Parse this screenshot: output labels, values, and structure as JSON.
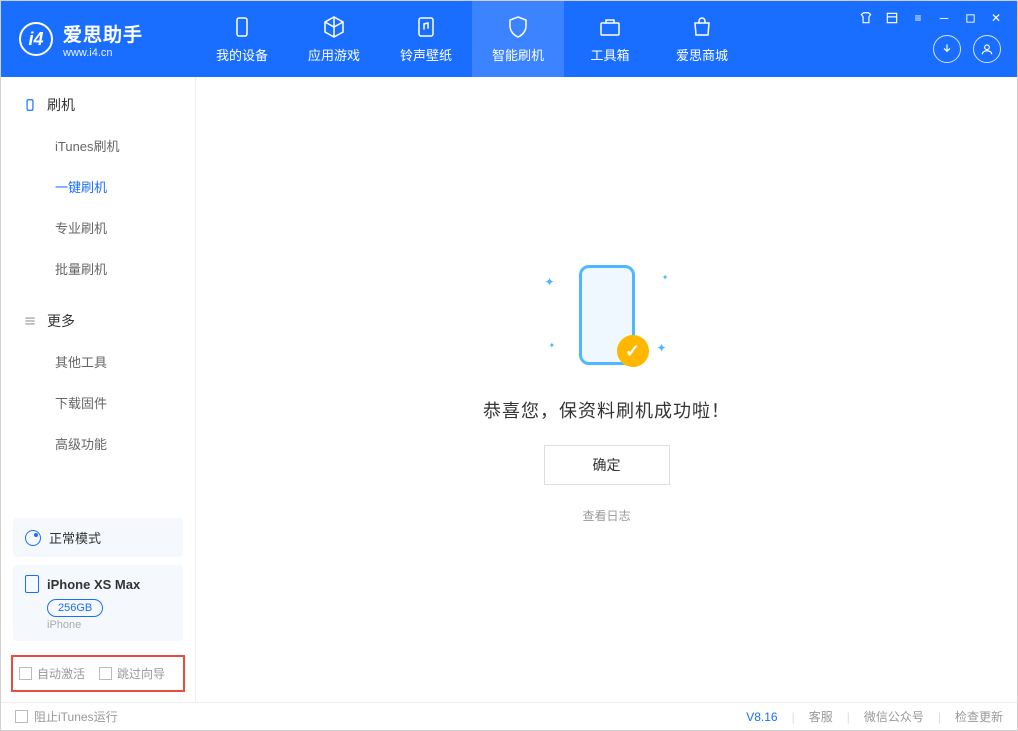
{
  "app": {
    "title": "爱思助手",
    "subtitle": "www.i4.cn"
  },
  "nav": [
    {
      "label": "我的设备"
    },
    {
      "label": "应用游戏"
    },
    {
      "label": "铃声壁纸"
    },
    {
      "label": "智能刷机"
    },
    {
      "label": "工具箱"
    },
    {
      "label": "爱思商城"
    }
  ],
  "sidebar": {
    "section1": {
      "title": "刷机",
      "items": [
        {
          "label": "iTunes刷机"
        },
        {
          "label": "一键刷机"
        },
        {
          "label": "专业刷机"
        },
        {
          "label": "批量刷机"
        }
      ]
    },
    "section2": {
      "title": "更多",
      "items": [
        {
          "label": "其他工具"
        },
        {
          "label": "下载固件"
        },
        {
          "label": "高级功能"
        }
      ]
    },
    "mode_label": "正常模式",
    "device_name": "iPhone XS Max",
    "device_capacity": "256GB",
    "device_type": "iPhone",
    "checkbox1": "自动激活",
    "checkbox2": "跳过向导"
  },
  "main": {
    "success_message": "恭喜您，保资料刷机成功啦！",
    "ok_button": "确定",
    "log_link": "查看日志"
  },
  "footer": {
    "itunes_block": "阻止iTunes运行",
    "version": "V8.16",
    "link_support": "客服",
    "link_wechat": "微信公众号",
    "link_update": "检查更新"
  }
}
